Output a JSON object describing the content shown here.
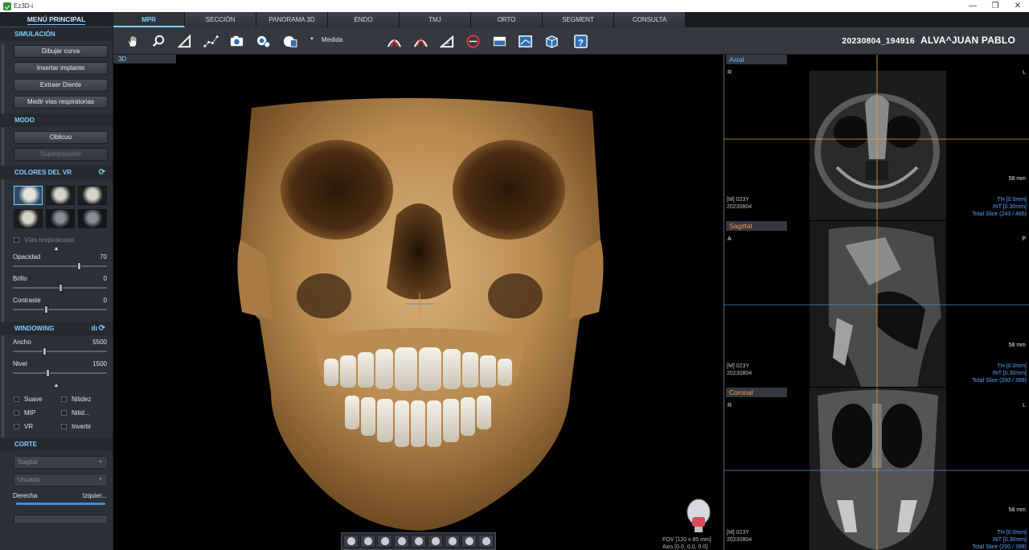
{
  "window": {
    "title": "Ez3D-i",
    "minimize": "—",
    "restore": "❐",
    "close": "✕"
  },
  "left_panel": {
    "header": "MENÚ PRINCIPAL",
    "simulacion": {
      "title": "SIMULACIÓN",
      "buttons": [
        "Dibujar curva",
        "Insertar implante",
        "Extraer Diente",
        "Medir vías respiratorias"
      ]
    },
    "modo": {
      "title": "MODO",
      "oblicuo": "Oblicuo",
      "superposicion": "Superposición"
    },
    "colores_vr": {
      "title": "COLORES DEL VR",
      "vias": "Vías respiratorias",
      "opacidad": {
        "label": "Opacidad",
        "value": "70",
        "fraction": 0.7
      },
      "brillo": {
        "label": "Brillo",
        "value": "0",
        "fraction": 0.5
      },
      "contraste": {
        "label": "Contraste",
        "value": "0",
        "fraction": 0.35
      }
    },
    "windowing": {
      "title": "WINDOWING",
      "ancho": {
        "label": "Ancho",
        "value": "5500",
        "fraction": 0.33
      },
      "nivel": {
        "label": "Nivel",
        "value": "1500",
        "fraction": 0.37
      },
      "options": [
        "Suave",
        "Nitidez",
        "MIP",
        "Nitid...",
        "VR",
        "Invertir"
      ]
    },
    "corte": {
      "title": "CORTE",
      "select1": "Sagital",
      "select2": "Usuario",
      "left_label": "Derecha",
      "right_label": "Izquier..."
    }
  },
  "tabs": [
    "MPR",
    "SECCIÓN",
    "PANORAMA 3D",
    "ENDO",
    "TMJ",
    "ORTO",
    "SEGMENT",
    "CONSULTA"
  ],
  "toolbar": {
    "medida": "Medida",
    "patient_id": "20230804_194916",
    "patient_name": "ALVA^JUAN PABLO"
  },
  "view3d": {
    "label": "3D",
    "fov_line1": "FOV [120 x 85 mm]",
    "fov_line2": "Axis [0.0, 0.0, 0.0]"
  },
  "axial": {
    "label": "Axial",
    "left": "R",
    "right": "L",
    "scale": "58 mm",
    "info_left": [
      "[M] 023Y",
      "20230804"
    ],
    "info_right": [
      "TH [0.0mm]",
      "INT [0.30mm]",
      "Total Slice (243 / 485)"
    ]
  },
  "sagittal": {
    "label": "Sagittal",
    "left": "A",
    "right": "P",
    "scale": "58 mm",
    "info_left": [
      "[M] 023Y",
      "20230804"
    ],
    "info_right": [
      "TH [0.0mm]",
      "INT [0.30mm]",
      "Total Slice (200 / 399)"
    ]
  },
  "coronal": {
    "label": "Coronal",
    "left": "R",
    "right": "L",
    "scale": "58 mm",
    "info_left": [
      "[M] 023Y",
      "20230804"
    ],
    "info_right": [
      "TH [0.0mm]",
      "INT [0.30mm]",
      "Total Slice (200 / 399)"
    ]
  },
  "colors": {
    "accent": "#7fd0ff",
    "panel": "#2c3137",
    "bone": "#c9a064",
    "axial_line": "#5aa8ff",
    "sagittal_line": "#ff9a3c"
  }
}
